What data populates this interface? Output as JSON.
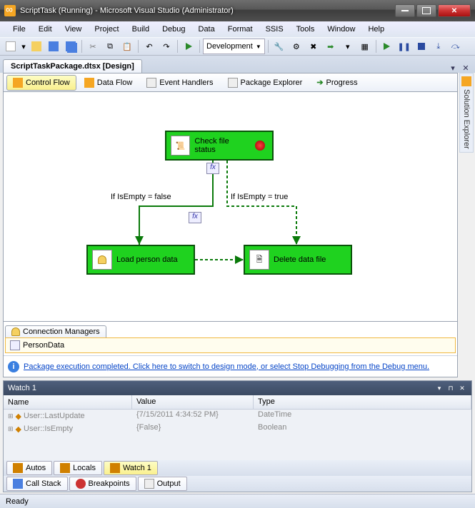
{
  "window": {
    "title": "ScriptTask (Running) - Microsoft Visual Studio (Administrator)"
  },
  "menus": [
    "File",
    "Edit",
    "View",
    "Project",
    "Build",
    "Debug",
    "Data",
    "Format",
    "SSIS",
    "Tools",
    "Window",
    "Help"
  ],
  "config_dropdown": "Development",
  "doc_tab": "ScriptTaskPackage.dtsx [Design]",
  "right_tab": "Solution Explorer",
  "subtabs": {
    "control_flow": "Control Flow",
    "data_flow": "Data Flow",
    "event_handlers": "Event Handlers",
    "package_explorer": "Package Explorer",
    "progress": "Progress"
  },
  "tasks": {
    "check": "Check file status",
    "load": "Load person data",
    "delete": "Delete data file"
  },
  "labels": {
    "false_branch": "If IsEmpty = false",
    "true_branch": "If IsEmpty = true",
    "fx": "fx"
  },
  "conn": {
    "tab": "Connection Managers",
    "item": "PersonData"
  },
  "info_msg": "Package execution completed. Click here to switch to design mode, or select Stop Debugging from the Debug menu.",
  "watch": {
    "title": "Watch 1",
    "cols": {
      "name": "Name",
      "value": "Value",
      "type": "Type"
    },
    "rows": [
      {
        "name": "User::LastUpdate",
        "value": "{7/15/2011 4:34:52 PM}",
        "type": "DateTime"
      },
      {
        "name": "User::IsEmpty",
        "value": "{False}",
        "type": "Boolean"
      }
    ]
  },
  "bottom_tabs1": {
    "autos": "Autos",
    "locals": "Locals",
    "watch1": "Watch 1"
  },
  "bottom_tabs2": {
    "callstack": "Call Stack",
    "breakpoints": "Breakpoints",
    "output": "Output"
  },
  "status": "Ready"
}
